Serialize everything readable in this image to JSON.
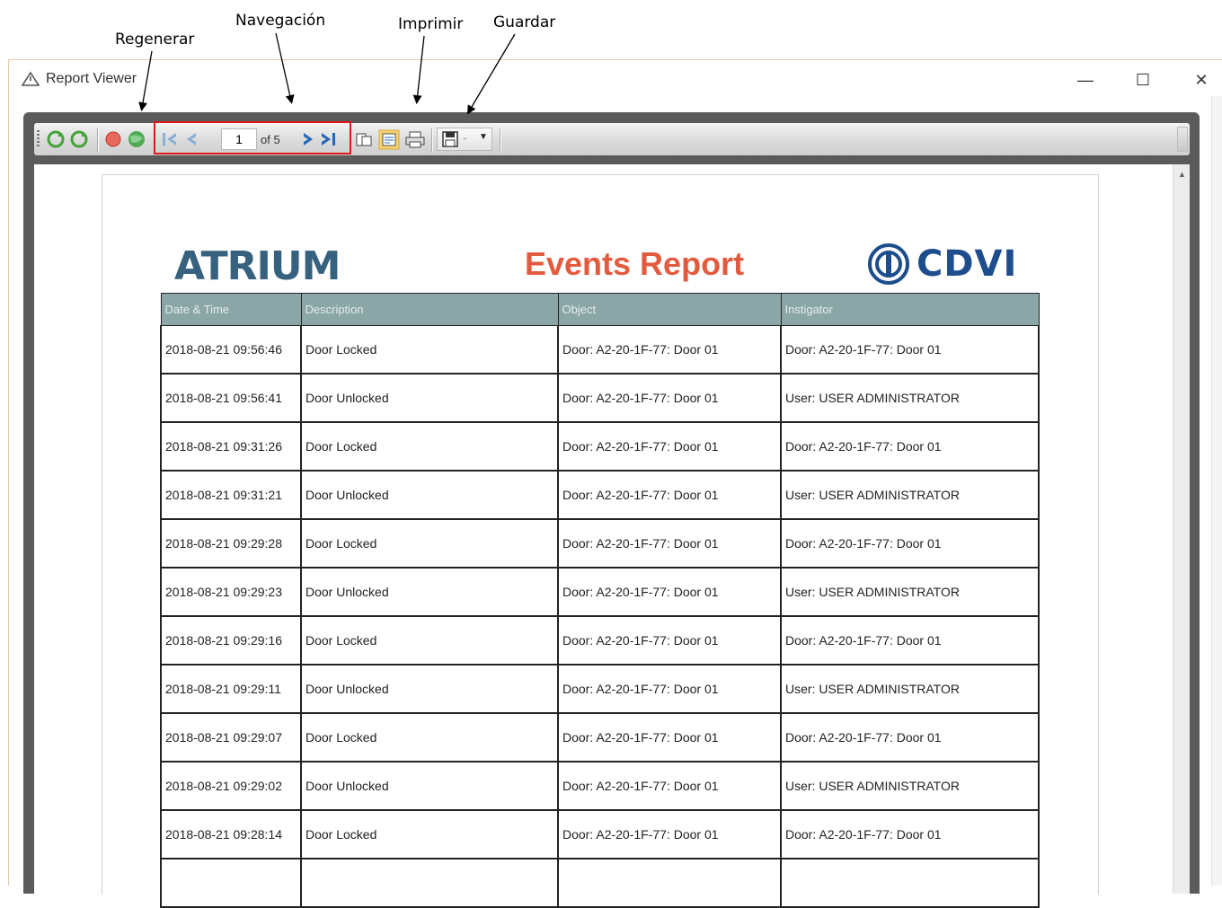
{
  "callouts": {
    "regenerar": "Regenerar",
    "navegacion": "Navegación",
    "imprimir": "Imprimir",
    "guardar": "Guardar"
  },
  "window": {
    "title": "Report Viewer",
    "icon": "warning-triangle-icon",
    "controls": {
      "minimize": "—",
      "maximize": "☐",
      "close": "✕"
    }
  },
  "toolbar": {
    "page_current": "1",
    "page_total_text": "of 5",
    "icons": [
      "refresh-icon",
      "refresh-icon",
      "stop-icon",
      "globe-icon",
      "first-page-icon",
      "previous-page-icon",
      "next-page-icon",
      "last-page-icon",
      "page-setup-icon",
      "print-layout-icon",
      "print-icon",
      "save-icon",
      "dropdown-icon"
    ]
  },
  "report": {
    "left_logo": "ATRIUM",
    "title": "Events Report",
    "right_logo": "CDVI",
    "columns": [
      "Date & Time",
      "Description",
      "Object",
      "Instigator"
    ],
    "rows": [
      [
        "2018-08-21 09:56:46",
        "Door Locked",
        "Door: A2-20-1F-77: Door 01",
        "Door: A2-20-1F-77: Door 01"
      ],
      [
        "2018-08-21 09:56:41",
        "Door Unlocked",
        "Door: A2-20-1F-77: Door 01",
        "User: USER ADMINISTRATOR"
      ],
      [
        "2018-08-21 09:31:26",
        "Door Locked",
        "Door: A2-20-1F-77: Door 01",
        "Door: A2-20-1F-77: Door 01"
      ],
      [
        "2018-08-21 09:31:21",
        "Door Unlocked",
        "Door: A2-20-1F-77: Door 01",
        "User: USER ADMINISTRATOR"
      ],
      [
        "2018-08-21 09:29:28",
        "Door Locked",
        "Door: A2-20-1F-77: Door 01",
        "Door: A2-20-1F-77: Door 01"
      ],
      [
        "2018-08-21 09:29:23",
        "Door Unlocked",
        "Door: A2-20-1F-77: Door 01",
        "User: USER ADMINISTRATOR"
      ],
      [
        "2018-08-21 09:29:16",
        "Door Locked",
        "Door: A2-20-1F-77: Door 01",
        "Door: A2-20-1F-77: Door 01"
      ],
      [
        "2018-08-21 09:29:11",
        "Door Unlocked",
        "Door: A2-20-1F-77: Door 01",
        "User: USER ADMINISTRATOR"
      ],
      [
        "2018-08-21 09:29:07",
        "Door Locked",
        "Door: A2-20-1F-77: Door 01",
        "Door: A2-20-1F-77: Door 01"
      ],
      [
        "2018-08-21 09:29:02",
        "Door Unlocked",
        "Door: A2-20-1F-77: Door 01",
        "User: USER ADMINISTRATOR"
      ],
      [
        "2018-08-21 09:28:14",
        "Door Locked",
        "Door: A2-20-1F-77: Door 01",
        "Door: A2-20-1F-77: Door 01"
      ],
      [
        "",
        "",
        "",
        ""
      ]
    ]
  },
  "colors": {
    "header_bg": "#8aa6a6",
    "title_red": "#e35b3e",
    "atrium_blue": "#36617f",
    "cdvi_blue": "#1d4d8c",
    "nav_highlight": "#e0161b"
  }
}
